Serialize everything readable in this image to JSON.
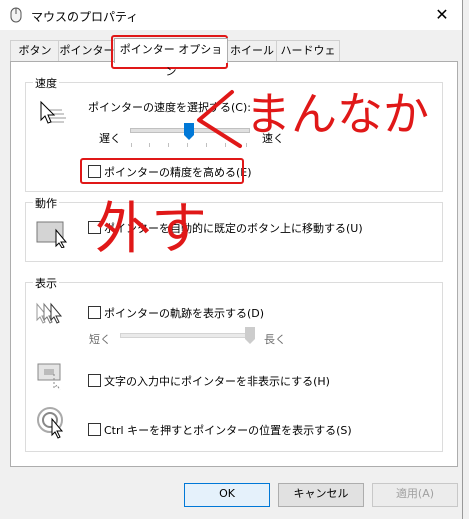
{
  "window": {
    "title": "マウスのプロパティ",
    "close_glyph": "✕"
  },
  "tabs": [
    {
      "label": "ボタン"
    },
    {
      "label": "ポインター"
    },
    {
      "label": "ポインター オプション"
    },
    {
      "label": "ホイール"
    },
    {
      "label": "ハードウェア"
    }
  ],
  "groups": {
    "speed": {
      "label": "速度",
      "slider_label": "ポインターの速度を選択する(C):",
      "slow": "遅く",
      "fast": "速く",
      "speed_value": 0.5,
      "precision_label": "ポインターの精度を高める(E)",
      "precision_checked": false
    },
    "motion": {
      "label": "動作",
      "snap_label": "ポインターを自動的に既定のボタン上に移動する(U)",
      "snap_checked": false
    },
    "visibility": {
      "label": "表示",
      "trails_label": "ポインターの軌跡を表示する(D)",
      "trails_checked": false,
      "short": "短く",
      "long": "長く",
      "trails_value": 1.0,
      "hide_label": "文字の入力中にポインターを非表示にする(H)",
      "hide_checked": false,
      "ctrl_label": "Ctrl キーを押すとポインターの位置を表示する(S)",
      "ctrl_checked": false
    }
  },
  "buttons": {
    "ok": "OK",
    "cancel": "キャンセル",
    "apply": "適用(A)"
  },
  "annotations": {
    "note1": "まんなか",
    "note2": "外す",
    "color": "#e01818"
  }
}
